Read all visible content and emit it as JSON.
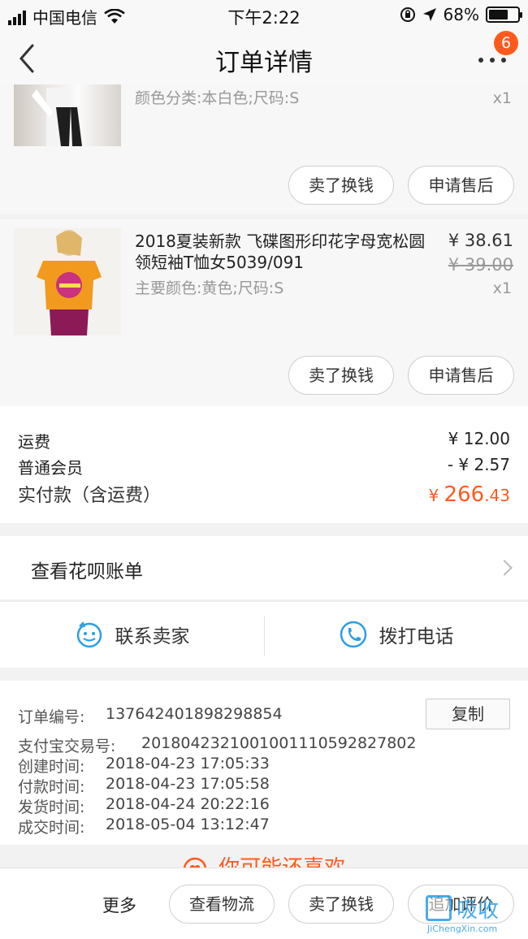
{
  "status_bar": {
    "carrier": "中国电信",
    "time": "下午2:22",
    "battery_percent": "68%",
    "battery_level": 0.68
  },
  "nav": {
    "title": "订单详情",
    "badge_count": "6",
    "icons": {
      "back": "chevron-left-icon",
      "more": "more-dots-icon"
    }
  },
  "products": [
    {
      "sku": "颜色分类:本白色;尺码:S",
      "quantity": "x1",
      "buttons": [
        "卖了换钱",
        "申请售后"
      ]
    },
    {
      "title": "2018夏装新款 飞碟图形印花字母宽松圆领短袖T恤女5039/091",
      "price": "¥ 38.61",
      "original_price": "¥ 39.00",
      "sku": "主要颜色:黄色;尺码:S",
      "quantity": "x1",
      "buttons": [
        "卖了换钱",
        "申请售后"
      ]
    }
  ],
  "fees": {
    "shipping_label": "运费",
    "shipping_value": "¥ 12.00",
    "member_label": "普通会员",
    "member_value": "- ¥ 2.57",
    "total_label": "实付款（含运费）",
    "total_currency": "¥ ",
    "total_int": "266",
    "total_dec": ".43"
  },
  "huabei_link": "查看花呗账单",
  "contact": {
    "seller": "联系卖家",
    "phone": "拨打电话"
  },
  "order_info": {
    "order_no_label": "订单编号:",
    "order_no": "137642401898298854",
    "copy_label": "复制",
    "alipay_label": "支付宝交易号:",
    "alipay_no": "2018042321001001110592827802",
    "created_label": "创建时间:",
    "created": "2018-04-23 17:05:33",
    "paid_label": "付款时间:",
    "paid": "2018-04-23 17:05:58",
    "shipped_label": "发货时间:",
    "shipped": "2018-04-24 20:22:16",
    "done_label": "成交时间:",
    "done": "2018-05-04 13:12:47"
  },
  "recommend_title": "你可能还喜欢",
  "bottom_bar": {
    "more": "更多",
    "buttons": [
      "查看物流",
      "卖了换钱",
      "追加评价"
    ]
  },
  "watermark": {
    "text": "吸收",
    "url": "JiChengXin.com"
  },
  "colors": {
    "accent": "#ff5a1e",
    "link_blue": "#2a9ee6"
  }
}
